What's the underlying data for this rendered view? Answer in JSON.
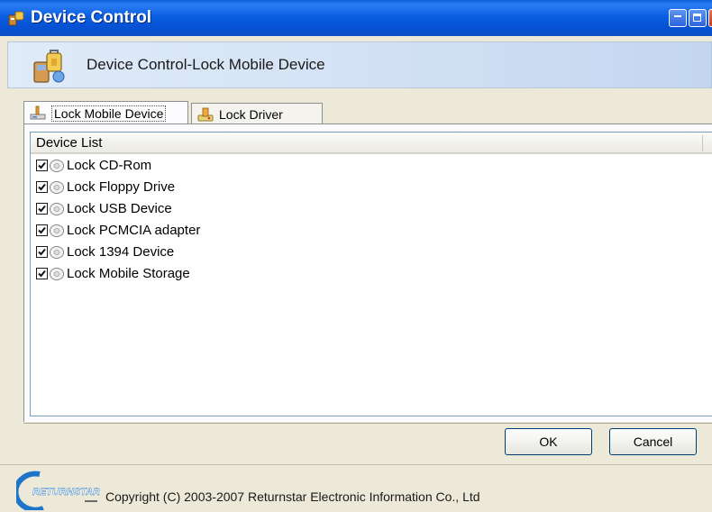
{
  "window": {
    "title": "Device Control",
    "controls": [
      "minimize-icon",
      "maximize-icon",
      "close-icon"
    ]
  },
  "header": {
    "title": "Device Control-Lock Mobile Device"
  },
  "tabs": [
    {
      "label": "Lock Mobile Device",
      "active": true
    },
    {
      "label": "Lock Driver",
      "active": false
    }
  ],
  "device_list": {
    "column_header": "Device List",
    "items": [
      {
        "label": "Lock CD-Rom",
        "checked": true
      },
      {
        "label": "Lock Floppy Drive",
        "checked": true
      },
      {
        "label": "Lock USB Device",
        "checked": true
      },
      {
        "label": "Lock PCMCIA adapter",
        "checked": true
      },
      {
        "label": "Lock 1394 Device",
        "checked": true
      },
      {
        "label": "Lock Mobile Storage",
        "checked": true
      }
    ]
  },
  "buttons": {
    "ok": "OK",
    "cancel": "Cancel"
  },
  "footer": {
    "logo_text": "RETURNSTAR",
    "copyright": "Copyright (C) 2003-2007 Returnstar Electronic Information Co., Ltd"
  },
  "colors": {
    "titlebar": "#0a5ee0",
    "header_band": "#d3e2f5",
    "dialog_bg": "#ece9d8"
  }
}
